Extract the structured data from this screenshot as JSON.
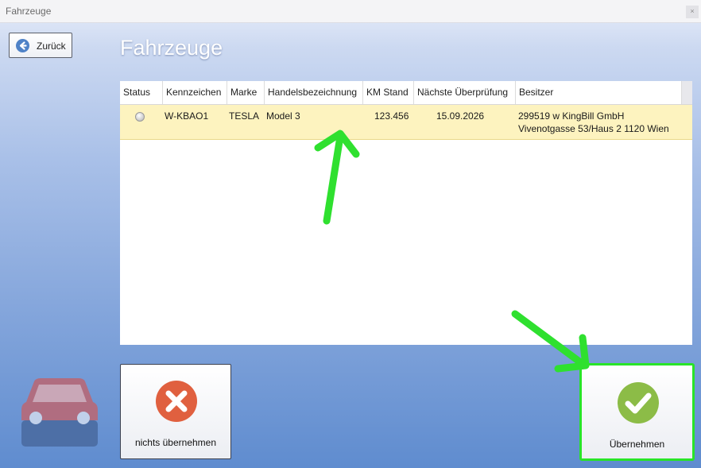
{
  "window": {
    "title": "Fahrzeuge",
    "close_glyph": "×"
  },
  "toolbar": {
    "back_label": "Zurück",
    "back_icon": "arrow-left-circle-icon"
  },
  "page": {
    "title": "Fahrzeuge"
  },
  "grid": {
    "columns": [
      "Status",
      "Kennzeichen",
      "Marke",
      "Handelsbezeichnung",
      "KM Stand",
      "Nächste Überprüfung",
      "Besitzer"
    ],
    "rows": [
      {
        "status": "",
        "kennzeichen": "W-KBAO1",
        "marke": "TESLA",
        "handelsbezeichnung": "Model 3",
        "km_stand": "123.456",
        "naechste_ueberpruefung": "15.09.2026",
        "besitzer_line1": "299519 w KingBill GmbH",
        "besitzer_line2": "Vivenotgasse 53/Haus 2 1120 Wien"
      }
    ],
    "selected_row_color": "#fdf3bf"
  },
  "actions": {
    "none_label": "nichts übernehmen",
    "none_icon": "red-x-icon",
    "none_color": "#e0603f",
    "ok_label": "Übernehmen",
    "ok_icon": "green-check-icon",
    "ok_color": "#8cbc47"
  },
  "annotations": {
    "arrow_color": "#2fe02f"
  },
  "decor": {
    "car_icon": "car-icon",
    "car_color": "#b06d80"
  }
}
